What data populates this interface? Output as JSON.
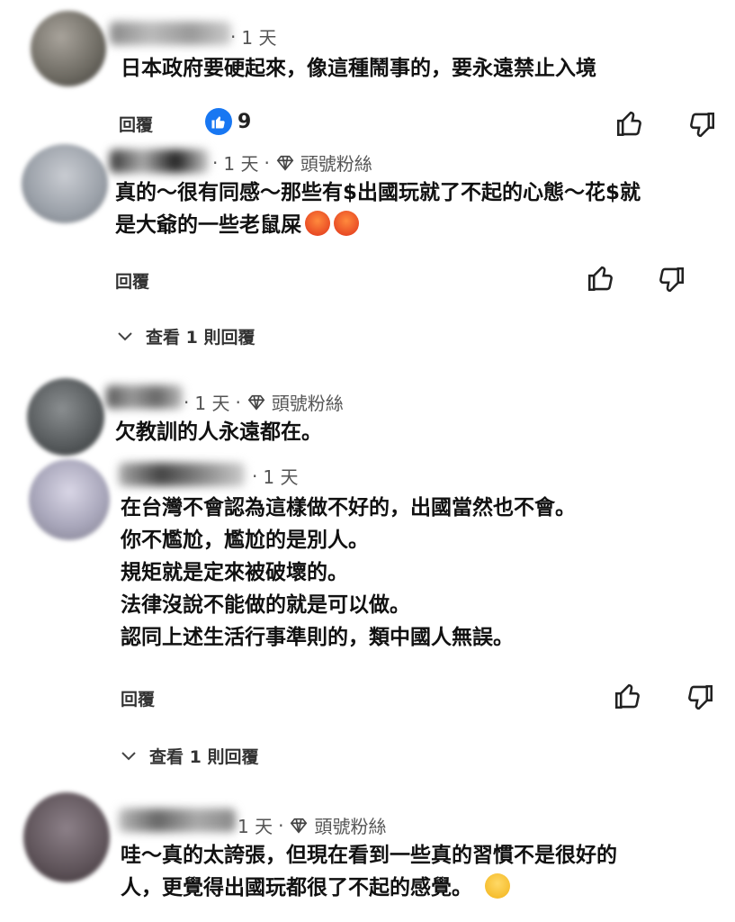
{
  "icons": {
    "reply_like": "thumbs-up-icon",
    "reply_dislike": "thumbs-down-icon",
    "badge": "diamond-icon",
    "chevron": "chevron-down-icon"
  },
  "colors": {
    "like_blue": "#1877f2",
    "text": "#111111",
    "meta": "#555555"
  },
  "comments": [
    {
      "time": "1 天",
      "text_lines": [
        "日本政府要硬起來，像這種鬧事的，要永遠禁止入境"
      ],
      "reply_label": "回覆",
      "like_count": "9"
    },
    {
      "time": "1 天",
      "sep": "·",
      "badge": "頭號粉絲",
      "text_lines": [
        "真的～很有同感～那些有$出國玩就了不起的心態～花$就",
        "是大爺的一些老鼠屎"
      ],
      "reply_label": "回覆",
      "view_replies": "查看 1 則回覆"
    },
    {
      "time": "1 天",
      "sep": "·",
      "badge": "頭號粉絲",
      "text_lines": [
        "欠教訓的人永遠都在。"
      ]
    },
    {
      "time": "1 天",
      "text_lines": [
        "在台灣不會認為這樣做不好的，出國當然也不會。",
        "你不尷尬，尷尬的是別人。",
        "規矩就是定來被破壞的。",
        "法律沒說不能做的就是可以做。",
        "認同上述生活行事準則的，類中國人無誤。"
      ],
      "reply_label": "回覆",
      "view_replies": "查看 1 則回覆"
    },
    {
      "time": "1 天",
      "sep": "·",
      "badge": "頭號粉絲",
      "text_lines": [
        "哇～真的太誇張，但現在看到一些真的習慣不是很好的",
        "人，更覺得出國玩都很了不起的感覺。"
      ]
    }
  ]
}
